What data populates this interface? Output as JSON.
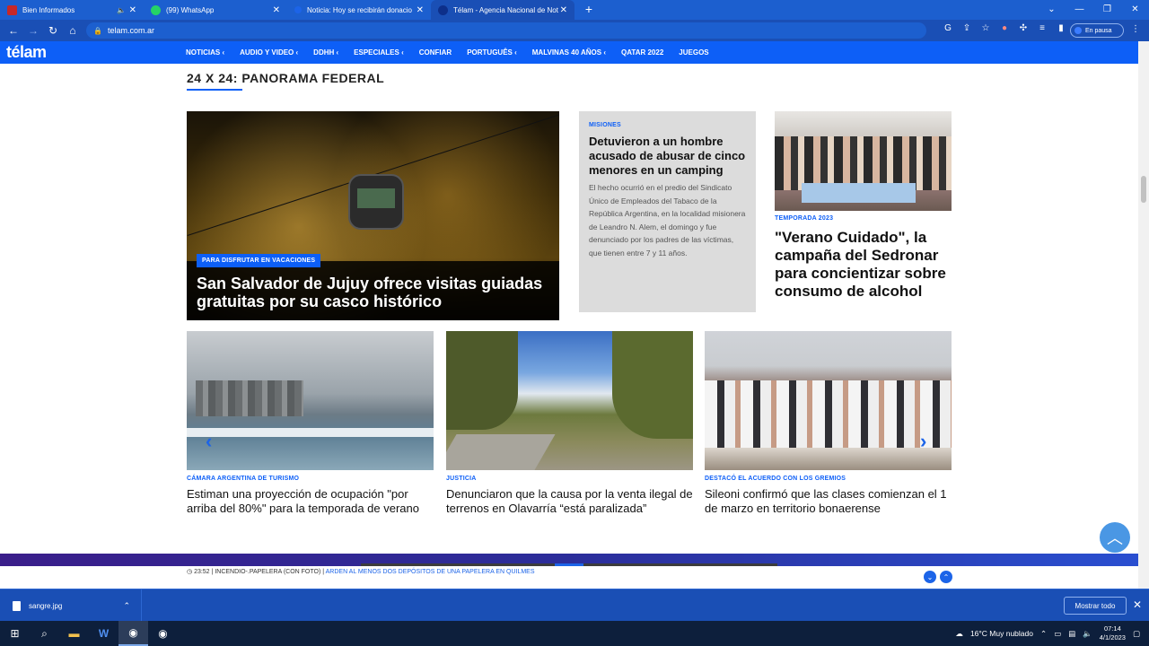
{
  "browser": {
    "tabs": [
      {
        "title": "Bien Informados",
        "favicon_color": "#c62828"
      },
      {
        "title": "(99) WhatsApp",
        "favicon_color": "#25d366"
      },
      {
        "title": "Noticia: Hoy se recibirán donacio",
        "favicon_color": "#1c64e8"
      },
      {
        "title": "Télam - Agencia Nacional de Not",
        "favicon_color": "#1c64e8"
      }
    ],
    "new_tab": "+",
    "url": "telam.com.ar",
    "profile_status": "En pausa"
  },
  "site": {
    "logo": "télam",
    "nav": [
      "NOTICIAS ‹",
      "AUDIO Y VIDEO ‹",
      "DDHH ‹",
      "ESPECIALES ‹",
      "CONFIAR",
      "PORTUGUÊS ‹",
      "MALVINAS 40 AÑOS ‹",
      "QATAR 2022",
      "JUEGOS"
    ]
  },
  "section": {
    "title": "24 X 24: PANORAMA FEDERAL"
  },
  "hero": {
    "tag": "PARA DISFRUTAR EN VACACIONES",
    "title": "San Salvador de Jujuy ofrece visitas guiadas gratuitas por su casco histórico"
  },
  "card2": {
    "category": "MISIONES",
    "title": "Detuvieron a un hombre acusado de abusar de cinco menores en un camping",
    "summary": "El hecho ocurrió en el predio del Sindicato Único de Empleados del Tabaco de la República Argentina, en la localidad misionera de Leandro N. Alem, el domingo y fue denunciado por los padres de las víctimas, que tienen entre 7 y 11 años."
  },
  "card3": {
    "category": "TEMPORADA 2023",
    "title": "\"Verano Cuidado\", la campaña del Sedronar para concientizar sobre consumo de alcohol"
  },
  "row2": [
    {
      "category": "CÁMARA ARGENTINA DE TURISMO",
      "title": "Estiman una proyección de ocupación \"por arriba del 80%\" para la temporada de verano"
    },
    {
      "category": "JUSTICIA",
      "title": "Denunciaron que la causa por la venta ilegal de terrenos en Olavarría “está paralizada”"
    },
    {
      "category": "DESTACÓ EL ACUERDO CON LOS GREMIOS",
      "title": "Sileoni confirmó que las clases comienzan el 1 de marzo en territorio bonaerense"
    }
  ],
  "ticker": {
    "time": "23:52",
    "label": "INCENDIO-.PAPELERA (CON FOTO)",
    "headline": "ARDEN AL MENOS DOS DEPÓSITOS DE UNA PAPELERA EN QUILMES"
  },
  "downloads": {
    "file": "sangre.jpg",
    "show_all": "Mostrar todo"
  },
  "taskbar": {
    "weather": "16°C  Muy nublado",
    "time": "07:14",
    "date": "4/1/2023"
  }
}
